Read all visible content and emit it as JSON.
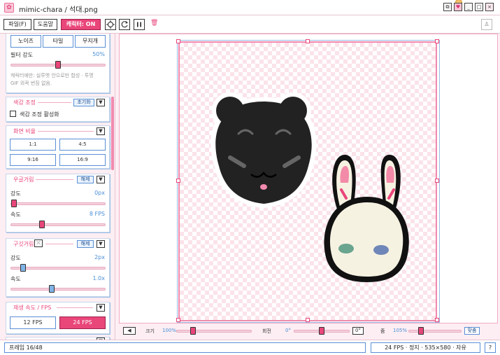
{
  "window": {
    "title": "mimic-chara / 석대.png",
    "controls": [
      "⧉",
      "♥",
      "_",
      "□",
      "×"
    ]
  },
  "toolbar": {
    "file": "파일(F)",
    "help": "도움말",
    "character": "캐릭터: ON",
    "delete_glyph": "🗑",
    "person_glyph": "♙"
  },
  "effects": {
    "noise": "노이즈",
    "tile": "타일",
    "rainbow": "무지개",
    "filter_label": "필터 강도",
    "filter_value": "50%",
    "filter_level": 0.5,
    "note_line1": "캐릭터에만: 실루엣 안으로만 합성 · 투명",
    "note_line2": "GIF 외곽 번짐 없음."
  },
  "color_adjust": {
    "header": "색감 조정",
    "reset": "초기화",
    "enable_label": "색감 조정 활성화"
  },
  "aspect": {
    "header": "화면 비율",
    "options": [
      "1:1",
      "4:5",
      "9:16",
      "16:9"
    ]
  },
  "bounce": {
    "header": "우글거림",
    "release": "해제",
    "strength_label": "강도",
    "strength_value": "0px",
    "strength_level": 0.0,
    "speed_label": "속도",
    "speed_value": "8 FPS",
    "speed_level": 0.32
  },
  "wobble": {
    "header": "구깃거림",
    "release": "해제",
    "strength_label": "강도",
    "strength_value": "2px",
    "strength_level": 0.1,
    "speed_label": "속도",
    "speed_value": "1.0x",
    "speed_level": 0.43
  },
  "playback": {
    "header": "재생 속도 / FPS",
    "options": [
      "12 FPS",
      "24 FPS"
    ],
    "selected": "24 FPS"
  },
  "canvas_controls": {
    "size_label": "크기",
    "size_value": "100%",
    "size_level": 0.19,
    "rotate_label": "회전",
    "rotate_value": "0°",
    "rotate_level": 0.5,
    "rotate_box": "0°",
    "zoom_label": "줌",
    "zoom_value": "105%",
    "zoom_level": 0.2,
    "fit": "맞춤"
  },
  "status": {
    "frame": "프레임 16/48",
    "info": "24 FPS · 정지 · 535×580 · 자유",
    "help": "?"
  },
  "colors": {
    "accent": "#e9467a",
    "border_blue": "#5a8fd6",
    "panel_bg": "#fdeef3"
  }
}
